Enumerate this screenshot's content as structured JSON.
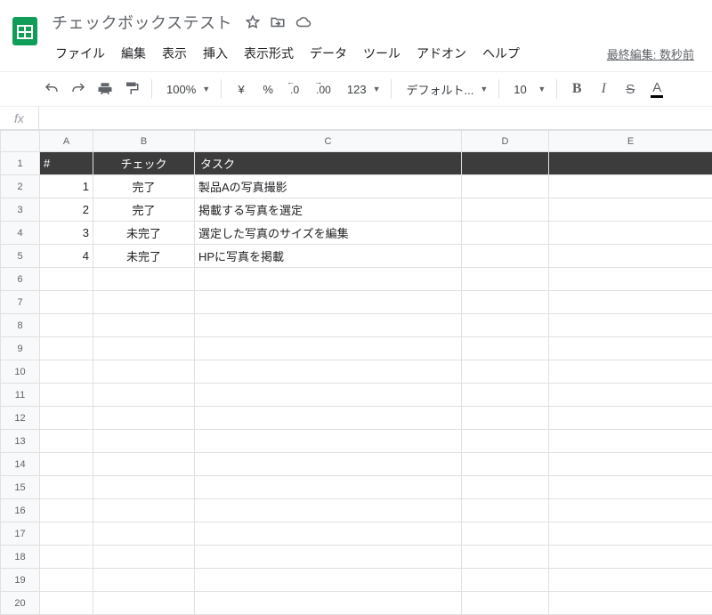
{
  "doc": {
    "title": "チェックボックステスト"
  },
  "menus": {
    "file": "ファイル",
    "edit": "編集",
    "view": "表示",
    "insert": "挿入",
    "format": "表示形式",
    "data": "データ",
    "tools": "ツール",
    "addons": "アドオン",
    "help": "ヘルプ"
  },
  "last_edit": "最終編集: 数秒前",
  "toolbar": {
    "zoom": "100%",
    "yen": "¥",
    "percent": "%",
    "dec_less": ".0",
    "dec_more": ".00",
    "num_fmt": "123",
    "font": "デフォルト...",
    "font_size": "10",
    "bold": "B",
    "italic": "I",
    "strike": "S",
    "text_color": "A"
  },
  "columns": [
    "A",
    "B",
    "C",
    "D",
    "E"
  ],
  "row_numbers": [
    1,
    2,
    3,
    4,
    5,
    6,
    7,
    8,
    9,
    10,
    11,
    12,
    13,
    14,
    15,
    16,
    17,
    18,
    19,
    20
  ],
  "sheet": {
    "header": {
      "a": "#",
      "b": "チェック",
      "c": "タスク"
    },
    "rows": [
      {
        "n": "1",
        "check": "完了",
        "task": "製品Aの写真撮影"
      },
      {
        "n": "2",
        "check": "完了",
        "task": "掲載する写真を選定"
      },
      {
        "n": "3",
        "check": "未完了",
        "task": "選定した写真のサイズを編集"
      },
      {
        "n": "4",
        "check": "未完了",
        "task": "HPに写真を掲載"
      }
    ]
  }
}
